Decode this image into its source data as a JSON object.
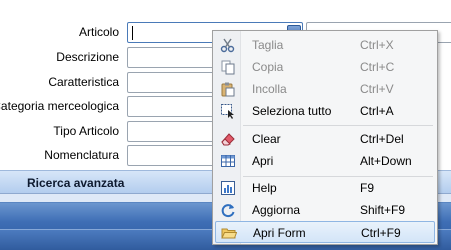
{
  "form": {
    "fields": [
      {
        "label": "Articolo",
        "focused": true
      },
      {
        "label": "Descrizione"
      },
      {
        "label": "Caratteristica"
      },
      {
        "label": "Categoria merceologica"
      },
      {
        "label": "Tipo Articolo"
      },
      {
        "label": "Nomenclatura"
      }
    ],
    "advanced_search": "Ricerca avanzata"
  },
  "context_menu": {
    "items": [
      {
        "label": "Taglia",
        "shortcut": "Ctrl+X",
        "icon": "scissors-icon",
        "disabled": true
      },
      {
        "label": "Copia",
        "shortcut": "Ctrl+C",
        "icon": "copy-icon",
        "disabled": true
      },
      {
        "label": "Incolla",
        "shortcut": "Ctrl+V",
        "icon": "paste-icon",
        "disabled": true
      },
      {
        "label": "Seleziona tutto",
        "shortcut": "Ctrl+A",
        "icon": "select-all-icon"
      },
      {
        "label": "Clear",
        "shortcut": "Ctrl+Del",
        "icon": "eraser-icon"
      },
      {
        "label": "Apri",
        "shortcut": "Alt+Down",
        "icon": "grid-icon"
      },
      {
        "label": "Help",
        "shortcut": "F9",
        "icon": "help-icon"
      },
      {
        "label": "Aggiorna",
        "shortcut": "Shift+F9",
        "icon": "refresh-icon"
      },
      {
        "label": "Apri Form",
        "shortcut": "Ctrl+F9",
        "icon": "folder-icon",
        "highlighted": true
      }
    ]
  },
  "colors": {
    "accent": "#3e6eb5",
    "highlight_border": "#8fb6e3",
    "disabled_text": "#8a8a8a"
  }
}
